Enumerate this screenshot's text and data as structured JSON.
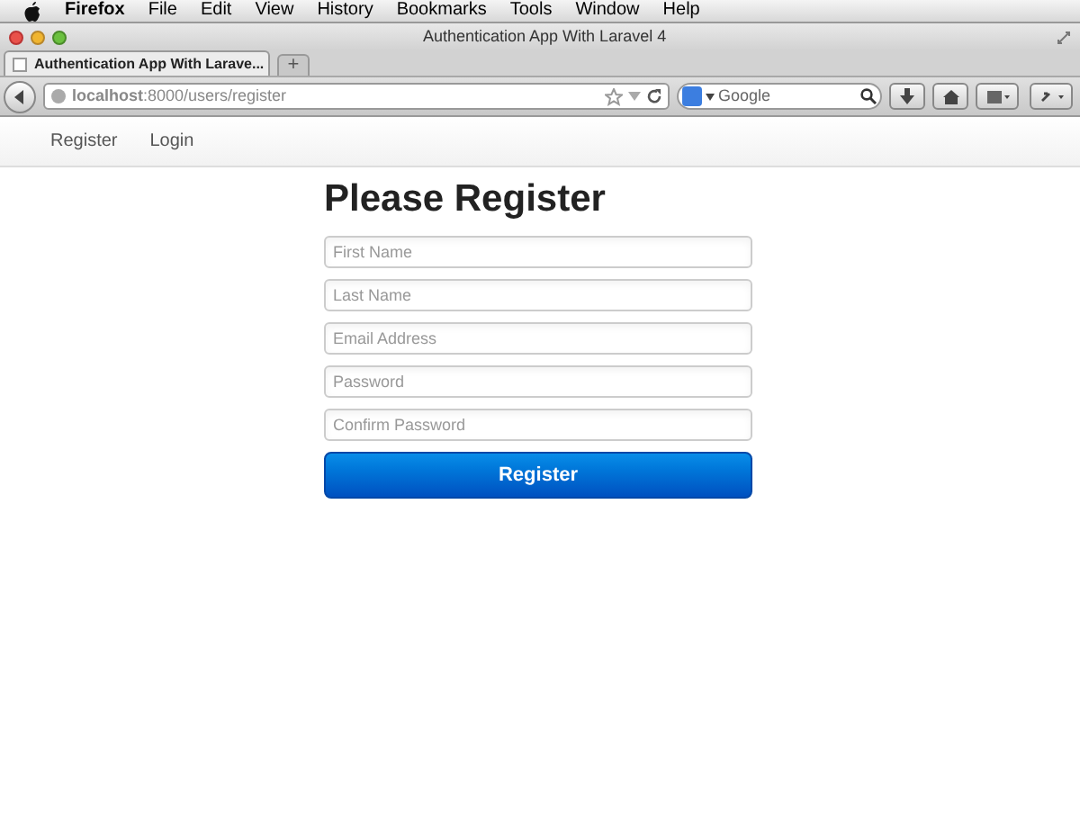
{
  "menu_bar": {
    "items": [
      {
        "label": "Firefox",
        "bold": true
      },
      {
        "label": "File",
        "bold": false
      },
      {
        "label": "Edit",
        "bold": false
      },
      {
        "label": "View",
        "bold": false
      },
      {
        "label": "History",
        "bold": false
      },
      {
        "label": "Bookmarks",
        "bold": false
      },
      {
        "label": "Tools",
        "bold": false
      },
      {
        "label": "Window",
        "bold": false
      },
      {
        "label": "Help",
        "bold": false
      }
    ]
  },
  "window": {
    "title": "Authentication App With Laravel 4"
  },
  "tabs": [
    {
      "label": "Authentication App With Larave...",
      "selected": true
    }
  ],
  "new_tab": "+",
  "address_bar": {
    "url": "**localhost**:8000/users/register"
  },
  "search": {
    "placeholder": "Google"
  },
  "nav": {
    "items": [
      {
        "label": "Register"
      },
      {
        "label": "Login"
      }
    ]
  },
  "form": {
    "heading": "Please Register",
    "fields": [
      {
        "placeholder": "First Name"
      },
      {
        "placeholder": "Last Name"
      },
      {
        "placeholder": "Email Address"
      },
      {
        "placeholder": "Password"
      },
      {
        "placeholder": "Confirm Password"
      }
    ],
    "submit": "Register"
  }
}
